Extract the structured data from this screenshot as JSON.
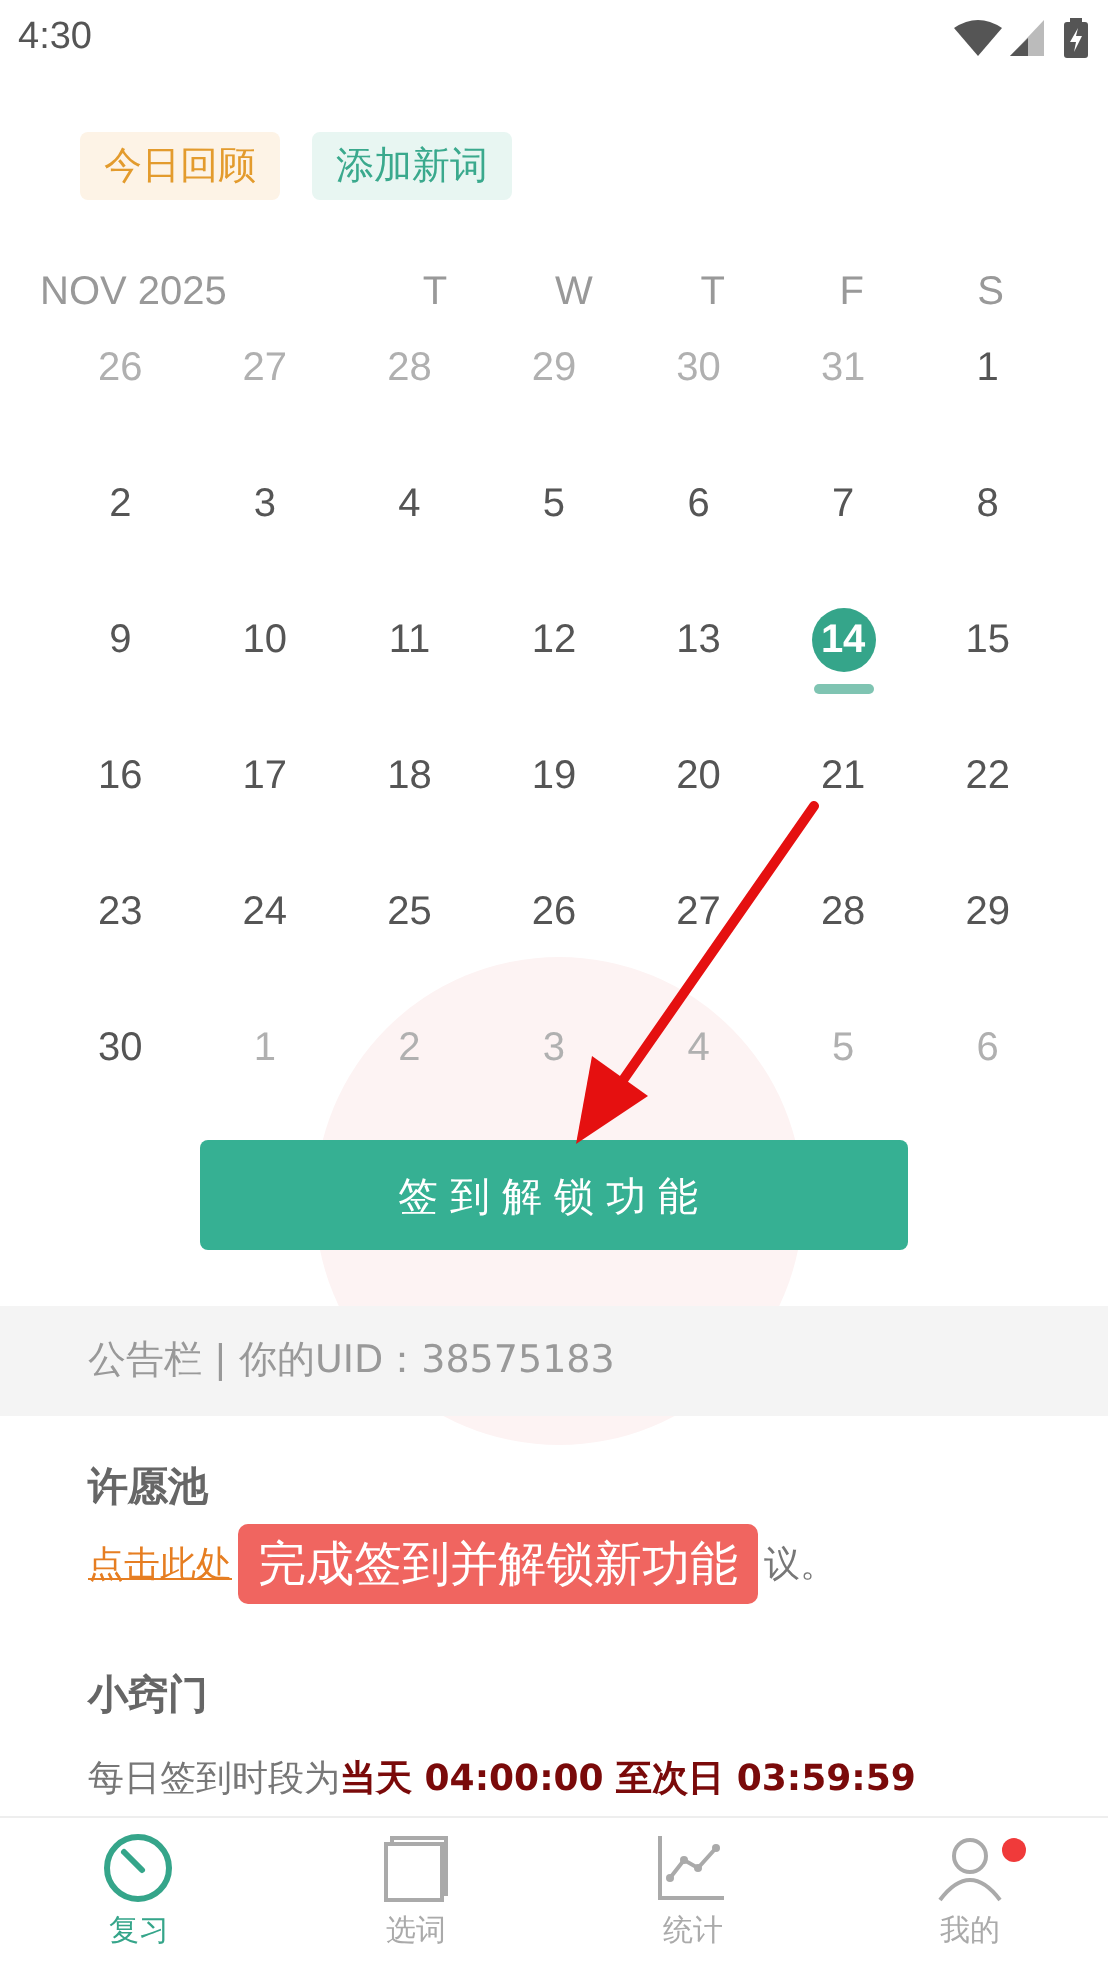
{
  "status_bar": {
    "time": "4:30"
  },
  "top_buttons": [
    {
      "label": "今日回顾",
      "kind": "review"
    },
    {
      "label": "添加新词",
      "kind": "add"
    }
  ],
  "calendar": {
    "month": "NOV 2025",
    "weekdays": [
      "T",
      "W",
      "T",
      "F",
      "S"
    ],
    "weeks": [
      [
        {
          "label": "26",
          "muted": true,
          "selected": false
        },
        {
          "label": "27",
          "muted": true,
          "selected": false
        },
        {
          "label": "28",
          "muted": true,
          "selected": false
        },
        {
          "label": "29",
          "muted": true,
          "selected": false
        },
        {
          "label": "30",
          "muted": true,
          "selected": false
        },
        {
          "label": "31",
          "muted": true,
          "selected": false
        },
        {
          "label": "1",
          "muted": false,
          "selected": false
        }
      ],
      [
        {
          "label": "2",
          "muted": false,
          "selected": false
        },
        {
          "label": "3",
          "muted": false,
          "selected": false
        },
        {
          "label": "4",
          "muted": false,
          "selected": false
        },
        {
          "label": "5",
          "muted": false,
          "selected": false
        },
        {
          "label": "6",
          "muted": false,
          "selected": false
        },
        {
          "label": "7",
          "muted": false,
          "selected": false
        },
        {
          "label": "8",
          "muted": false,
          "selected": false
        }
      ],
      [
        {
          "label": "9",
          "muted": false,
          "selected": false
        },
        {
          "label": "10",
          "muted": false,
          "selected": false
        },
        {
          "label": "11",
          "muted": false,
          "selected": false
        },
        {
          "label": "12",
          "muted": false,
          "selected": false
        },
        {
          "label": "13",
          "muted": false,
          "selected": false
        },
        {
          "label": "14",
          "muted": false,
          "selected": true
        },
        {
          "label": "15",
          "muted": false,
          "selected": false
        }
      ],
      [
        {
          "label": "16",
          "muted": false,
          "selected": false
        },
        {
          "label": "17",
          "muted": false,
          "selected": false
        },
        {
          "label": "18",
          "muted": false,
          "selected": false
        },
        {
          "label": "19",
          "muted": false,
          "selected": false
        },
        {
          "label": "20",
          "muted": false,
          "selected": false
        },
        {
          "label": "21",
          "muted": false,
          "selected": false
        },
        {
          "label": "22",
          "muted": false,
          "selected": false
        }
      ],
      [
        {
          "label": "23",
          "muted": false,
          "selected": false
        },
        {
          "label": "24",
          "muted": false,
          "selected": false
        },
        {
          "label": "25",
          "muted": false,
          "selected": false
        },
        {
          "label": "26",
          "muted": false,
          "selected": false
        },
        {
          "label": "27",
          "muted": false,
          "selected": false
        },
        {
          "label": "28",
          "muted": false,
          "selected": false
        },
        {
          "label": "29",
          "muted": false,
          "selected": false
        }
      ],
      [
        {
          "label": "30",
          "muted": false,
          "selected": false
        },
        {
          "label": "1",
          "muted": true,
          "selected": false
        },
        {
          "label": "2",
          "muted": true,
          "selected": false
        },
        {
          "label": "3",
          "muted": true,
          "selected": false
        },
        {
          "label": "4",
          "muted": true,
          "selected": false
        },
        {
          "label": "5",
          "muted": true,
          "selected": false
        },
        {
          "label": "6",
          "muted": true,
          "selected": false
        }
      ]
    ]
  },
  "checkin_button": {
    "label": "签到解锁功能"
  },
  "notice_bar": {
    "text": "公告栏 | 你的UID：38575183"
  },
  "wish_pool": {
    "title": "许愿池",
    "link": "点击此处",
    "text_tail": "议。"
  },
  "tips": {
    "title": "小窍门",
    "text": "每日签到时段为**当天 04:00:00 至次日 03:59:59**"
  },
  "annotation": {
    "label": "完成签到并解锁新功能"
  },
  "bottom_nav": [
    {
      "label": "复习",
      "kind": "gauge",
      "selected": true,
      "dot": false
    },
    {
      "label": "选词",
      "kind": "cards",
      "selected": false,
      "dot": false
    },
    {
      "label": "统计",
      "kind": "chart",
      "selected": false,
      "dot": false
    },
    {
      "label": "我的",
      "kind": "user",
      "selected": false,
      "dot": true
    }
  ]
}
